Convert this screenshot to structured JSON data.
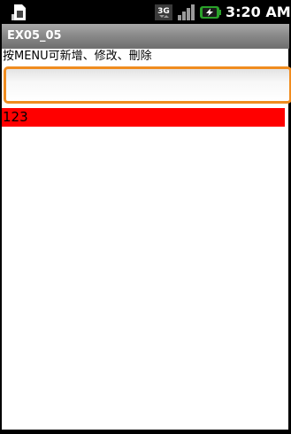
{
  "status_bar": {
    "time": "3:20 AM",
    "network_label": "3G",
    "icons": [
      "sim-card-icon",
      "network-3g-icon",
      "signal-strength-icon",
      "battery-charging-icon"
    ]
  },
  "app": {
    "title": "EX05_05"
  },
  "main": {
    "hint": "按MENU可新增、修改、刪除",
    "input_value": "",
    "list_items": [
      "123"
    ]
  },
  "colors": {
    "input_focus_border": "#f08c1f",
    "list_item_background": "#ff0000",
    "title_bar": "#8a8a8a"
  }
}
